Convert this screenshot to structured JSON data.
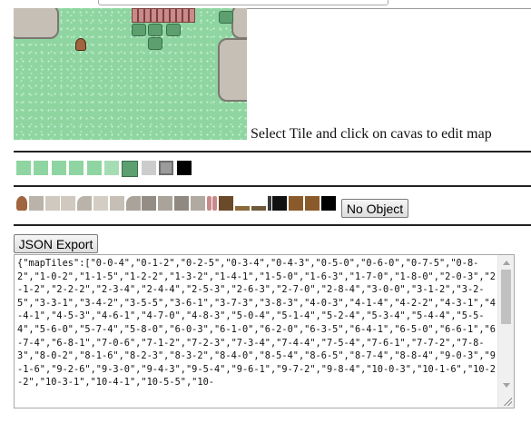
{
  "caption": "Select Tile and click on cavas to edit map",
  "tiles": [
    {
      "name": "grass-tile-1",
      "color": "#8fd5a1"
    },
    {
      "name": "grass-tile-2",
      "color": "#8fd5a1"
    },
    {
      "name": "grass-tile-3",
      "color": "#8fd5a1"
    },
    {
      "name": "grass-tile-4",
      "color": "#8fd5a1"
    },
    {
      "name": "grass-tile-5",
      "color": "#8fd5a1"
    },
    {
      "name": "grass-tile-6",
      "color": "#a6dcb3"
    },
    {
      "name": "bush-tile",
      "color": "#5d9f6f"
    },
    {
      "name": "stone-tile",
      "color": "#cccccc"
    },
    {
      "name": "stone-block-tile",
      "color": "#9b9b9b"
    },
    {
      "name": "black-tile",
      "color": "#000000"
    }
  ],
  "objects": [
    {
      "name": "sign-object",
      "color": "#a0643e"
    },
    {
      "name": "rock-edge-object",
      "color": "#b9b3a9"
    },
    {
      "name": "rock-tile-object-1",
      "color": "#cfc9bf"
    },
    {
      "name": "rock-tile-object-2",
      "color": "#cfc9bf"
    },
    {
      "name": "rock-corner-object-1",
      "color": "#b9b3a9"
    },
    {
      "name": "rock-tile-object-3",
      "color": "#d3cdc3"
    },
    {
      "name": "rock-tile-object-4",
      "color": "#c5bfb5"
    },
    {
      "name": "rock-corner-object-2",
      "color": "#a9a39a"
    },
    {
      "name": "rock-object-5",
      "color": "#938d85"
    },
    {
      "name": "rock-object-6",
      "color": "#a9a39a"
    },
    {
      "name": "rock-object-7",
      "color": "#8f8981"
    },
    {
      "name": "rock-object-8",
      "color": "#b0aaa0"
    },
    {
      "name": "fence-post-object-1",
      "color": "#c98a8a"
    },
    {
      "name": "fence-post-object-2",
      "color": "#c98a8a"
    },
    {
      "name": "table-object",
      "color": "#6b4a2a"
    },
    {
      "name": "ledge-object-1",
      "color": "#8a6a3a"
    },
    {
      "name": "ledge-object-2",
      "color": "#6e5a3a"
    },
    {
      "name": "post-object",
      "color": "#3a3a3a"
    },
    {
      "name": "tv-object",
      "color": "#111111"
    },
    {
      "name": "shelf-object-1",
      "color": "#8a5a2a"
    },
    {
      "name": "shelf-object-2",
      "color": "#8a5a2a"
    },
    {
      "name": "black-object",
      "color": "#000000"
    }
  ],
  "buttons": {
    "no_object": "No Object",
    "json_export": "JSON Export"
  },
  "json_text": "{\"mapTiles\":[\"0-0-4\",\"0-1-2\",\"0-2-5\",\"0-3-4\",\"0-4-3\",\"0-5-0\",\"0-6-0\",\"0-7-5\",\"0-8-2\",\"1-0-2\",\"1-1-5\",\"1-2-2\",\"1-3-2\",\"1-4-1\",\"1-5-0\",\"1-6-3\",\"1-7-0\",\"1-8-0\",\"2-0-3\",\"2-1-2\",\"2-2-2\",\"2-3-4\",\"2-4-4\",\"2-5-3\",\"2-6-3\",\"2-7-0\",\"2-8-4\",\"3-0-0\",\"3-1-2\",\"3-2-5\",\"3-3-1\",\"3-4-2\",\"3-5-5\",\"3-6-1\",\"3-7-3\",\"3-8-3\",\"4-0-3\",\"4-1-4\",\"4-2-2\",\"4-3-1\",\"4-4-1\",\"4-5-3\",\"4-6-1\",\"4-7-0\",\"4-8-3\",\"5-0-4\",\"5-1-4\",\"5-2-4\",\"5-3-4\",\"5-4-4\",\"5-5-4\",\"5-6-0\",\"5-7-4\",\"5-8-0\",\"6-0-3\",\"6-1-0\",\"6-2-0\",\"6-3-5\",\"6-4-1\",\"6-5-0\",\"6-6-1\",\"6-7-4\",\"6-8-1\",\"7-0-6\",\"7-1-2\",\"7-2-3\",\"7-3-4\",\"7-4-4\",\"7-5-4\",\"7-6-1\",\"7-7-2\",\"7-8-3\",\"8-0-2\",\"8-1-6\",\"8-2-3\",\"8-3-2\",\"8-4-0\",\"8-5-4\",\"8-6-5\",\"8-7-4\",\"8-8-4\",\"9-0-3\",\"9-1-6\",\"9-2-6\",\"9-3-0\",\"9-4-3\",\"9-5-4\",\"9-6-1\",\"9-7-2\",\"9-8-4\",\"10-0-3\",\"10-1-6\",\"10-2-2\",\"10-3-1\",\"10-4-1\",\"10-5-5\",\"10-"
}
